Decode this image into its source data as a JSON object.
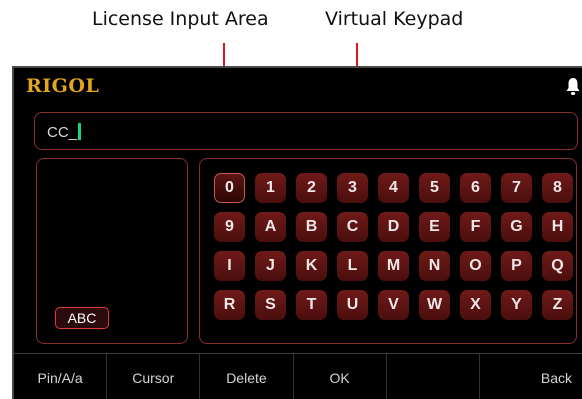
{
  "callouts": {
    "license_input_area": "License Input Area",
    "virtual_keypad": "Virtual Keypad"
  },
  "header": {
    "brand": "RIGOL",
    "notification_icon": "bell-icon"
  },
  "license_input": {
    "value": "CC_"
  },
  "input_mode": {
    "label": "ABC"
  },
  "keypad": {
    "keys": [
      "0",
      "1",
      "2",
      "3",
      "4",
      "5",
      "6",
      "7",
      "8",
      "9",
      "A",
      "B",
      "C",
      "D",
      "E",
      "F",
      "G",
      "H",
      "I",
      "J",
      "K",
      "L",
      "M",
      "N",
      "O",
      "P",
      "Q",
      "R",
      "S",
      "T",
      "U",
      "V",
      "W",
      "X",
      "Y",
      "Z"
    ],
    "selected_key": "0"
  },
  "softkeys": [
    "Pin/A/a",
    "Cursor",
    "Delete",
    "OK",
    "",
    "Back"
  ],
  "colors": {
    "brand": "#e3a41e",
    "annotation_arrow": "#e0161c",
    "cursor": "#19d47a",
    "key_bg": "#5e1513"
  }
}
